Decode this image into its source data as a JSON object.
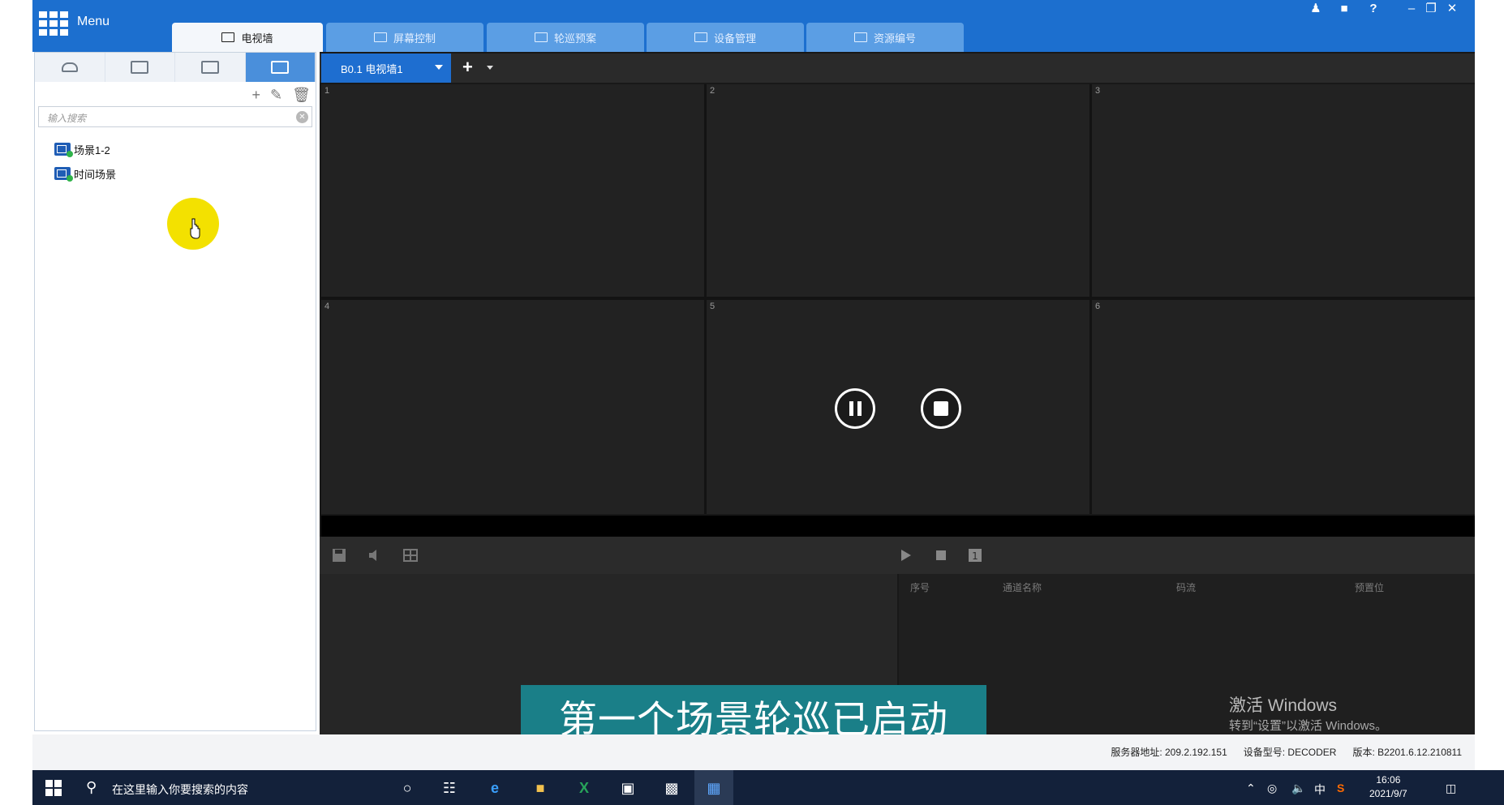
{
  "app": {
    "menu_label": "Menu"
  },
  "tabs": [
    {
      "label": "电视墙"
    },
    {
      "label": "屏幕控制"
    },
    {
      "label": "轮巡预案"
    },
    {
      "label": "设备管理"
    },
    {
      "label": "资源编号"
    }
  ],
  "left_panel": {
    "search_placeholder": "输入搜索",
    "tree": [
      {
        "label": "场景1-2"
      },
      {
        "label": "时间场景"
      }
    ]
  },
  "video_tabs": {
    "active": "B0.1 电视墙1"
  },
  "grid_cells": [
    "1",
    "2",
    "3",
    "4",
    "5",
    "6"
  ],
  "table_headers": [
    "序号",
    "通道名称",
    "码流",
    "预置位"
  ],
  "subtitle": "第一个场景轮巡已启动",
  "watermark": {
    "line1": "激活 Windows",
    "line2": "转到“设置”以激活 Windows。"
  },
  "status_bar": {
    "server": "服务器地址: 209.2.192.151",
    "device": "设备型号: DECODER",
    "version": "版本: B2201.6.12.210811"
  },
  "taskbar": {
    "search_text": "在这里输入你要搜索的内容",
    "ime": "中",
    "time": "16:06",
    "date": "2021/9/7"
  },
  "colors": {
    "accent": "#1c6fcf",
    "subtitle_bg": "#1a7f88",
    "taskbar": "#13213a"
  }
}
